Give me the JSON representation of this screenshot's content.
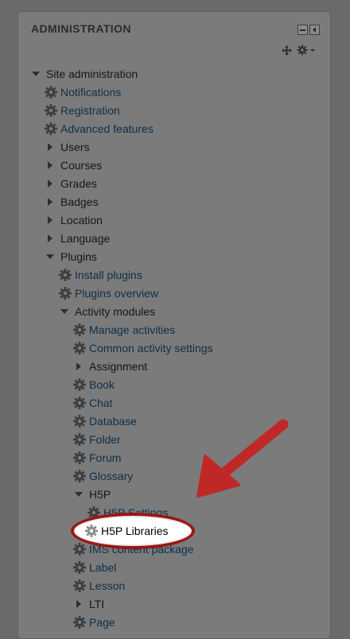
{
  "block": {
    "title": "ADMINISTRATION"
  },
  "tree": [
    {
      "label": "Site administration",
      "type": "expanded",
      "link": false
    },
    {
      "label": "Notifications",
      "type": "gear",
      "link": true
    },
    {
      "label": "Registration",
      "type": "gear",
      "link": true
    },
    {
      "label": "Advanced features",
      "type": "gear",
      "link": true
    },
    {
      "label": "Users",
      "type": "collapsed",
      "link": false
    },
    {
      "label": "Courses",
      "type": "collapsed",
      "link": false
    },
    {
      "label": "Grades",
      "type": "collapsed",
      "link": false
    },
    {
      "label": "Badges",
      "type": "collapsed",
      "link": false
    },
    {
      "label": "Location",
      "type": "collapsed",
      "link": false
    },
    {
      "label": "Language",
      "type": "collapsed",
      "link": false
    },
    {
      "label": "Plugins",
      "type": "expanded",
      "link": false
    },
    {
      "label": "Install plugins",
      "type": "gear",
      "link": true
    },
    {
      "label": "Plugins overview",
      "type": "gear",
      "link": true
    },
    {
      "label": "Activity modules",
      "type": "expanded",
      "link": false
    },
    {
      "label": "Manage activities",
      "type": "gear",
      "link": true
    },
    {
      "label": "Common activity settings",
      "type": "gear",
      "link": true
    },
    {
      "label": "Assignment",
      "type": "collapsed",
      "link": false
    },
    {
      "label": "Book",
      "type": "gear",
      "link": true
    },
    {
      "label": "Chat",
      "type": "gear",
      "link": true
    },
    {
      "label": "Database",
      "type": "gear",
      "link": true
    },
    {
      "label": "Folder",
      "type": "gear",
      "link": true
    },
    {
      "label": "Forum",
      "type": "gear",
      "link": true
    },
    {
      "label": "Glossary",
      "type": "gear",
      "link": true
    },
    {
      "label": "H5P",
      "type": "expanded",
      "link": false
    },
    {
      "label": "H5P Settings",
      "type": "gear",
      "link": true
    },
    {
      "label": "H5P Libraries",
      "type": "gear",
      "link": true
    },
    {
      "label": "IMS content package",
      "type": "gear",
      "link": true
    },
    {
      "label": "Label",
      "type": "gear",
      "link": true
    },
    {
      "label": "Lesson",
      "type": "gear",
      "link": true
    },
    {
      "label": "LTI",
      "type": "collapsed",
      "link": false
    },
    {
      "label": "Page",
      "type": "gear",
      "link": true
    }
  ],
  "highlight": {
    "label": "H5P Libraries"
  },
  "icons": {
    "gear": "gear-icon",
    "expanded": "triangle-down-icon",
    "collapsed": "triangle-right-icon",
    "dock": "dock-icon",
    "collapse": "collapse-icon",
    "move": "move-icon",
    "actions": "gear-menu-icon"
  },
  "colors": {
    "arrow": "#c02828",
    "ellipse_border": "#9a1717"
  }
}
